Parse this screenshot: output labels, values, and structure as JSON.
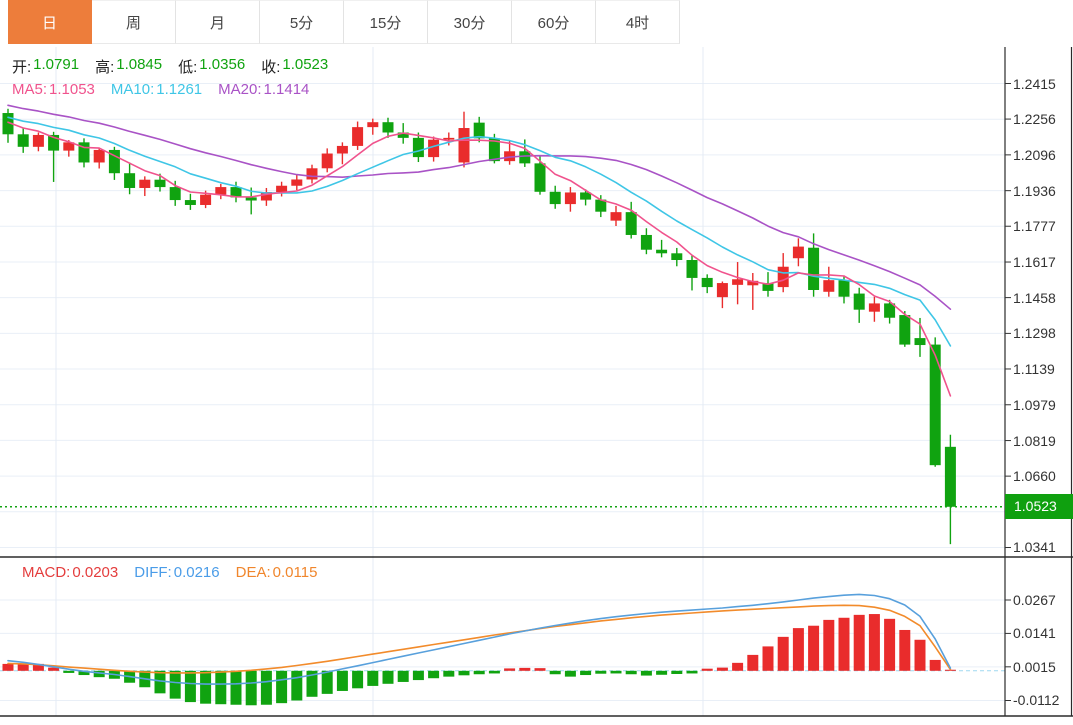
{
  "tabs": [
    {
      "id": "day",
      "label": "日",
      "active": true
    },
    {
      "id": "week",
      "label": "周",
      "active": false
    },
    {
      "id": "month",
      "label": "月",
      "active": false
    },
    {
      "id": "5min",
      "label": "5分",
      "active": false
    },
    {
      "id": "15min",
      "label": "15分",
      "active": false
    },
    {
      "id": "30min",
      "label": "30分",
      "active": false
    },
    {
      "id": "60min",
      "label": "60分",
      "active": false
    },
    {
      "id": "4hour",
      "label": "4时",
      "active": false
    }
  ],
  "ohlc": {
    "open_label": "开:",
    "open": "1.0791",
    "high_label": "高:",
    "high": "1.0845",
    "low_label": "低:",
    "low": "1.0356",
    "close_label": "收:",
    "close": "1.0523"
  },
  "ma": {
    "ma5_label": "MA5:",
    "ma5": "1.1053",
    "ma10_label": "MA10:",
    "ma10": "1.1261",
    "ma20_label": "MA20:",
    "ma20": "1.1414"
  },
  "macd_header": {
    "macd_label": "MACD:",
    "macd": "0.0203",
    "diff_label": "DIFF:",
    "diff": "0.0216",
    "dea_label": "DEA:",
    "dea": "0.0115"
  },
  "price_axis": {
    "ticks": [
      "1.2415",
      "1.2256",
      "1.2096",
      "1.1936",
      "1.1777",
      "1.1617",
      "1.1458",
      "1.1298",
      "1.1139",
      "1.0979",
      "1.0819",
      "1.0660",
      "1.0341"
    ],
    "current": "1.0523"
  },
  "macd_axis": {
    "ticks": [
      "0.0267",
      "0.0141",
      "0.0015",
      "-0.0112"
    ]
  },
  "colors": {
    "up": "#E92C2C",
    "down": "#10A310",
    "ma5": "#F0538D",
    "ma10": "#3FC6E6",
    "ma20": "#A953C6",
    "diff_line": "#58A0DC",
    "dea_line": "#F28B2B",
    "accent_tab": "#ED7D3B",
    "badge": "#0FA00F",
    "grid": "#E9EFF7",
    "vgrid": "#E4EBF4",
    "axis_text": "#333333",
    "border": "#2B2B2B",
    "zero_dash": "#9FD8F0",
    "current_dotted": "#12A312",
    "macd_text": "#E43D3D",
    "diff_text": "#4A9CE8",
    "dea_text": "#F0862C",
    "value_green": "#10A310",
    "label_dark": "#222222"
  },
  "chart_data": {
    "type": "candlestick",
    "title": "Daily candlestick chart with MA5/MA10/MA20 overlay and MACD sub-panel",
    "legend": [
      "MA5",
      "MA10",
      "MA20",
      "MACD",
      "DIFF",
      "DEA"
    ],
    "color_convention": "red = up candle, green = down candle",
    "price_axis_ticks": [
      1.2415,
      1.2256,
      1.2096,
      1.1936,
      1.1777,
      1.1617,
      1.1458,
      1.1298,
      1.1139,
      1.0979,
      1.0819,
      1.066,
      1.0341
    ],
    "macd_axis_ticks": [
      0.0267,
      0.0141,
      0.0015,
      -0.0112
    ],
    "current_price": 1.0523,
    "last_bar": {
      "open": 1.0791,
      "high": 1.0845,
      "low": 1.0356,
      "close": 1.0523
    },
    "ma_values": {
      "ma5": 1.1053,
      "ma10": 1.1261,
      "ma20": 1.1414
    },
    "macd_values": {
      "macd": 0.0203,
      "diff": 0.0216,
      "dea": 0.0115
    },
    "candles": [
      [
        1.2283,
        1.2302,
        1.215,
        1.2188
      ],
      [
        1.2188,
        1.2215,
        1.2105,
        1.2132
      ],
      [
        1.2132,
        1.2196,
        1.2112,
        1.2185
      ],
      [
        1.2185,
        1.2199,
        1.1975,
        1.2115
      ],
      [
        1.2115,
        1.2162,
        1.2088,
        1.2152
      ],
      [
        1.2152,
        1.217,
        1.204,
        1.2062
      ],
      [
        1.2062,
        1.2126,
        1.2035,
        1.2118
      ],
      [
        1.2118,
        1.2132,
        1.1984,
        1.2014
      ],
      [
        1.2014,
        1.2062,
        1.192,
        1.1948
      ],
      [
        1.1948,
        1.2,
        1.1912,
        1.1985
      ],
      [
        1.1985,
        1.2012,
        1.1932,
        1.1952
      ],
      [
        1.1952,
        1.198,
        1.1868,
        1.1894
      ],
      [
        1.1894,
        1.1922,
        1.185,
        1.1872
      ],
      [
        1.1872,
        1.1936,
        1.1858,
        1.1918
      ],
      [
        1.1918,
        1.1966,
        1.1898,
        1.1952
      ],
      [
        1.1952,
        1.1976,
        1.1884,
        1.1906
      ],
      [
        1.1906,
        1.195,
        1.183,
        1.1892
      ],
      [
        1.1892,
        1.1948,
        1.1868,
        1.193
      ],
      [
        1.193,
        1.1976,
        1.191,
        1.1958
      ],
      [
        1.1958,
        1.2006,
        1.1938,
        1.1986
      ],
      [
        1.1986,
        1.2052,
        1.1968,
        1.2036
      ],
      [
        1.2036,
        1.2125,
        1.2018,
        1.2102
      ],
      [
        1.2102,
        1.2152,
        1.2054,
        1.2136
      ],
      [
        1.2136,
        1.2245,
        1.2118,
        1.222
      ],
      [
        1.222,
        1.2258,
        1.2186,
        1.2242
      ],
      [
        1.2242,
        1.2262,
        1.2172,
        1.2196
      ],
      [
        1.2196,
        1.2238,
        1.2146,
        1.2172
      ],
      [
        1.2172,
        1.2196,
        1.2064,
        1.2086
      ],
      [
        1.2086,
        1.2178,
        1.2066,
        1.2164
      ],
      [
        1.2164,
        1.2196,
        1.2138,
        1.2172
      ],
      [
        1.2062,
        1.2289,
        1.204,
        1.2216
      ],
      [
        1.224,
        1.2266,
        1.2152,
        1.217
      ],
      [
        1.217,
        1.219,
        1.2058,
        1.2068
      ],
      [
        1.2068,
        1.2162,
        1.2052,
        1.2112
      ],
      [
        1.2112,
        1.2165,
        1.2042,
        1.2058
      ],
      [
        1.2058,
        1.209,
        1.1918,
        1.1931
      ],
      [
        1.1931,
        1.1958,
        1.1855,
        1.1876
      ],
      [
        1.1876,
        1.1952,
        1.1842,
        1.1928
      ],
      [
        1.1928,
        1.1942,
        1.187,
        1.1896
      ],
      [
        1.1896,
        1.1916,
        1.1818,
        1.1842
      ],
      [
        1.1802,
        1.1868,
        1.1778,
        1.184
      ],
      [
        1.184,
        1.1886,
        1.1722,
        1.1738
      ],
      [
        1.1738,
        1.1768,
        1.1652,
        1.1672
      ],
      [
        1.1672,
        1.1716,
        1.1638,
        1.1656
      ],
      [
        1.1656,
        1.168,
        1.1598,
        1.1626
      ],
      [
        1.1626,
        1.1648,
        1.149,
        1.1546
      ],
      [
        1.1546,
        1.1562,
        1.1478,
        1.1505
      ],
      [
        1.146,
        1.153,
        1.1411,
        1.1523
      ],
      [
        1.1515,
        1.1617,
        1.1428,
        1.154
      ],
      [
        1.1513,
        1.1568,
        1.1403,
        1.1533
      ],
      [
        1.1523,
        1.1572,
        1.1462,
        1.1488
      ],
      [
        1.1505,
        1.1657,
        1.1482,
        1.1596
      ],
      [
        1.1634,
        1.1723,
        1.1598,
        1.1686
      ],
      [
        1.1681,
        1.1745,
        1.1462,
        1.1492
      ],
      [
        1.1484,
        1.1596,
        1.1462,
        1.1536
      ],
      [
        1.1536,
        1.1556,
        1.1432,
        1.1462
      ],
      [
        1.1476,
        1.1502,
        1.1345,
        1.1404
      ],
      [
        1.1395,
        1.1462,
        1.135,
        1.1432
      ],
      [
        1.1432,
        1.1448,
        1.1342,
        1.1368
      ],
      [
        1.138,
        1.1398,
        1.1238,
        1.1248
      ],
      [
        1.1277,
        1.1367,
        1.1193,
        1.1246
      ],
      [
        1.1248,
        1.128,
        1.0702,
        1.0709
      ],
      [
        1.0791,
        1.0845,
        1.0356,
        1.0523
      ]
    ],
    "ma_seed_closes": [
      1.242,
      1.241,
      1.24,
      1.239,
      1.2378,
      1.2366,
      1.2354,
      1.2342,
      1.233,
      1.2318,
      1.2306,
      1.2295,
      1.2285,
      1.2276,
      1.2268,
      1.2262,
      1.2257,
      1.2253,
      1.225
    ],
    "macd": {
      "diff": [
        0.0038,
        0.0032,
        0.0024,
        0.0015,
        0.0006,
        -0.0002,
        -0.0008,
        -0.0014,
        -0.0022,
        -0.003,
        -0.0038,
        -0.0044,
        -0.0048,
        -0.005,
        -0.005,
        -0.0049,
        -0.0046,
        -0.0041,
        -0.0034,
        -0.0026,
        -0.0016,
        -0.0005,
        0.0007,
        0.0019,
        0.0031,
        0.0043,
        0.0055,
        0.0067,
        0.0079,
        0.0091,
        0.0103,
        0.0115,
        0.0127,
        0.0139,
        0.015,
        0.0161,
        0.0171,
        0.018,
        0.0189,
        0.0197,
        0.0204,
        0.021,
        0.0216,
        0.0221,
        0.0225,
        0.0229,
        0.0233,
        0.0237,
        0.0242,
        0.0247,
        0.0253,
        0.026,
        0.0267,
        0.0274,
        0.028,
        0.0285,
        0.0288,
        0.0284,
        0.0272,
        0.0248,
        0.0205,
        0.012,
        0.001
      ],
      "dea": [
        0.0028,
        0.0026,
        0.0023,
        0.0019,
        0.0014,
        0.001,
        0.0006,
        0.0002,
        -0.0002,
        -0.0005,
        -0.0007,
        -0.0008,
        -0.0008,
        -0.0007,
        -0.0005,
        -0.0002,
        0.0002,
        0.0007,
        0.0013,
        0.002,
        0.0028,
        0.0036,
        0.0045,
        0.0054,
        0.0063,
        0.0072,
        0.0081,
        0.009,
        0.0099,
        0.0108,
        0.0117,
        0.0126,
        0.0135,
        0.0143,
        0.0151,
        0.0159,
        0.0167,
        0.0174,
        0.0181,
        0.0188,
        0.0194,
        0.02,
        0.0205,
        0.021,
        0.0214,
        0.0218,
        0.0222,
        0.0226,
        0.0229,
        0.0232,
        0.0235,
        0.0238,
        0.0241,
        0.0244,
        0.0246,
        0.0247,
        0.0246,
        0.024,
        0.0228,
        0.0205,
        0.017,
        0.009,
        0.0005
      ],
      "hist": [
        0.0026,
        0.0028,
        0.0026,
        0.0012,
        -0.0008,
        -0.0016,
        -0.0024,
        -0.003,
        -0.0045,
        -0.0062,
        -0.0085,
        -0.0105,
        -0.0118,
        -0.0124,
        -0.0126,
        -0.0128,
        -0.013,
        -0.0128,
        -0.0122,
        -0.0112,
        -0.0098,
        -0.0087,
        -0.0076,
        -0.0066,
        -0.0057,
        -0.0049,
        -0.0042,
        -0.0035,
        -0.0028,
        -0.0022,
        -0.0017,
        -0.0013,
        -0.001,
        0.0009,
        0.0011,
        0.001,
        -0.0013,
        -0.0022,
        -0.0016,
        -0.0011,
        -0.001,
        -0.0013,
        -0.0018,
        -0.0015,
        -0.0012,
        -0.001,
        0.0008,
        0.0012,
        0.003,
        0.006,
        0.0092,
        0.0128,
        0.0161,
        0.017,
        0.0192,
        0.02,
        0.0211,
        0.0214,
        0.0196,
        0.0154,
        0.0117,
        0.0041,
        0.0004
      ]
    }
  }
}
